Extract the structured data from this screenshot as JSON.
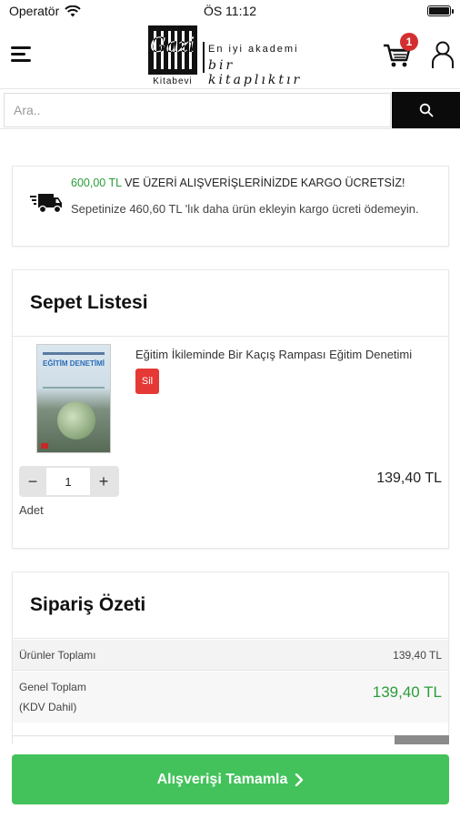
{
  "status_bar": {
    "carrier": "Operatör",
    "time": "ÖS 11:12"
  },
  "header": {
    "logo_sub": "Kitabevi",
    "logo_tagline1": "En iyi akademi",
    "logo_tagline2": "bir kitaplıktır",
    "cart_count": "1"
  },
  "search": {
    "placeholder": "Ara.."
  },
  "shipping": {
    "threshold": "600,00 TL",
    "headline": " VE ÜZERİ ALIŞVERİŞLERİNİZDE KARGO ÜCRETSİZ!",
    "message": "Sepetinize 460,60 TL 'lık daha ürün ekleyin kargo ücreti ödemeyin."
  },
  "cart": {
    "title": "Sepet Listesi",
    "items": [
      {
        "title": "Eğitim İkileminde Bir Kaçış Rampası Eğitim Denetimi",
        "cover_text": "EĞİTİM DENETİMİ",
        "delete_label": "Sil",
        "quantity": "1",
        "qty_label": "Adet",
        "price": "139,40 TL"
      }
    ]
  },
  "summary": {
    "title": "Sipariş Özeti",
    "products_total_label": "Ürünler Toplamı",
    "products_total_value": "139,40 TL",
    "grand_total_label": "Genel Toplam",
    "grand_total_note": "(KDV Dahil)",
    "grand_total_value": "139,40 TL"
  },
  "checkout": {
    "label": "Alışverişi Tamamla"
  },
  "colors": {
    "accent_green": "#43c25b",
    "price_green": "#2a9d3a",
    "badge_red": "#d32f2f",
    "delete_red": "#e53935"
  }
}
